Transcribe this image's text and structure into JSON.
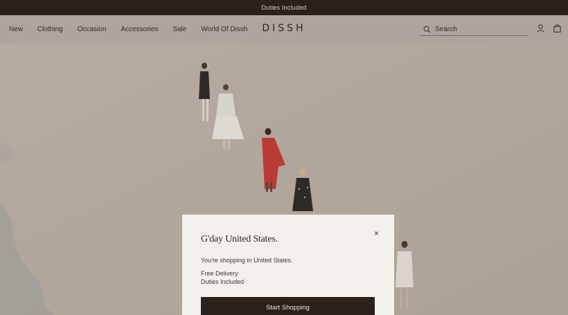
{
  "announcement": "Duties Included",
  "nav": [
    "New",
    "Clothing",
    "Occasion",
    "Accessories",
    "Sale",
    "World Of Dissh"
  ],
  "logo": "DISSH",
  "search": {
    "placeholder": "Search"
  },
  "icons": {
    "search": "search-icon",
    "account": "user-icon",
    "bag": "bag-icon"
  },
  "modal": {
    "title": "G'day United States.",
    "shopping_in": "You're shopping in United States.",
    "line1": "Free Delivery",
    "line2": "Duties Included",
    "button": "Start Shopping",
    "close": "×"
  },
  "colors": {
    "topbar": "#2a211d",
    "header": "#aea59f",
    "sand": "#b5aca3",
    "modal": "#f4f1ed",
    "button": "#2a211d"
  }
}
